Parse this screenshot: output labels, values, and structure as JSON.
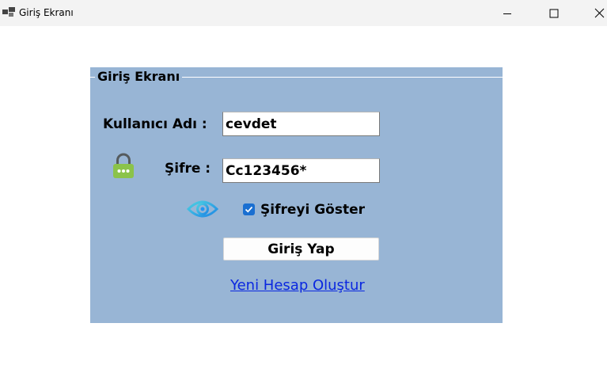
{
  "window": {
    "title": "Giriş Ekranı"
  },
  "groupbox": {
    "legend": "Giriş Ekranı",
    "background_color": "#98b5d5"
  },
  "form": {
    "username_label": "Kullanıcı Adı :",
    "username_value": "cevdet",
    "password_label": "Şifre :",
    "password_value": "Cc123456*",
    "show_password_label": "Şifreyi Göster",
    "show_password_checked": true,
    "login_button": "Giriş Yap",
    "create_account_link": "Yeni Hesap Oluştur"
  },
  "colors": {
    "link": "#0a27e0",
    "checkbox": "#1a6fd1",
    "lock": "#8bc34a",
    "eye": "#26c6da"
  }
}
